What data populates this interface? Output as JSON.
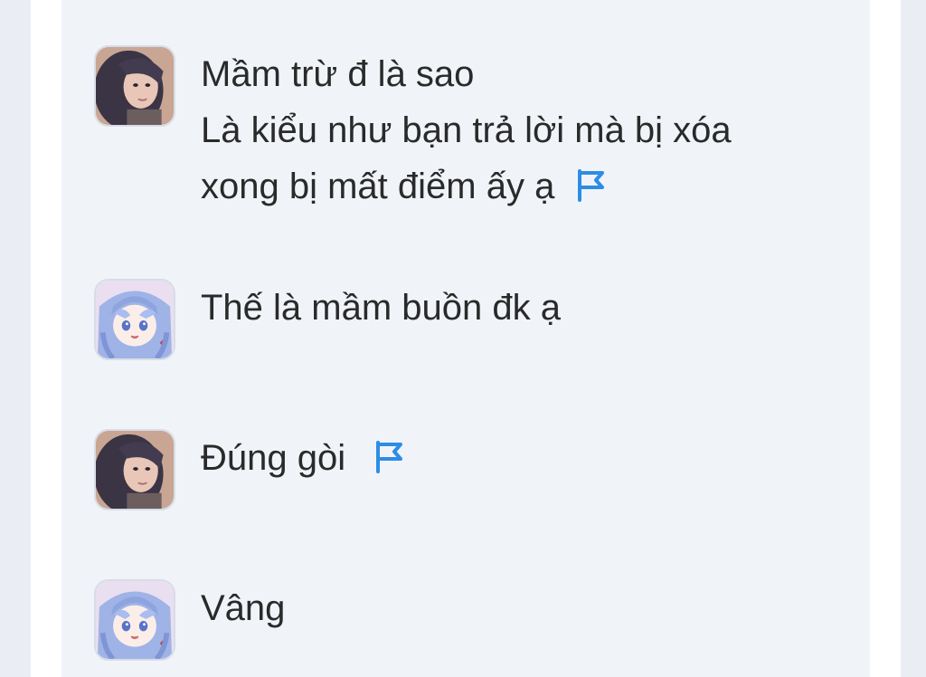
{
  "colors": {
    "panel_background": "#f0f4f9",
    "page_background": "#ffffff",
    "outer_background": "#eaeef4",
    "text": "#2a2a2a",
    "flag_accent": "#2d8de6"
  },
  "comments": [
    {
      "author_avatar": "girl-photo-avatar",
      "lines": [
        "Mầm trừ đ là sao",
        "Là kiểu như bạn trả lời mà bị xóa",
        "xong bị mất điểm ấy ạ"
      ],
      "has_report_flag": true
    },
    {
      "author_avatar": "anime-girl-avatar",
      "lines": [
        "Thế là mầm buồn đk ạ"
      ],
      "has_report_flag": false
    },
    {
      "author_avatar": "girl-photo-avatar",
      "lines": [
        "Đúng gòi"
      ],
      "has_report_flag": true
    },
    {
      "author_avatar": "anime-girl-avatar",
      "lines": [
        "Vâng"
      ],
      "has_report_flag": false
    }
  ]
}
